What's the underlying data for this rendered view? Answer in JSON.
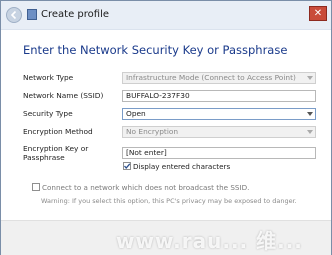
{
  "window": {
    "title": "Create profile",
    "close_glyph": "✕"
  },
  "heading": "Enter the Network Security Key or Passphrase",
  "form": {
    "network_type": {
      "label": "Network Type",
      "value": "Infrastructure Mode (Connect to Access Point)"
    },
    "network_name": {
      "label": "Network Name (SSID)",
      "value": "BUFFALO-237F30"
    },
    "security_type": {
      "label": "Security Type",
      "value": "Open"
    },
    "encryption_method": {
      "label": "Encryption Method",
      "value": "No Encryption"
    },
    "encryption_key": {
      "label_line1": "Encryption Key or",
      "label_line2": "Passphrase",
      "value": "[Not enter]"
    },
    "display_chars": {
      "label": "Display entered characters",
      "checked": true
    },
    "hidden_ssid": {
      "label": "Connect to a network which does not broadcast the SSID.",
      "checked": false
    },
    "warning": "Warning: If you select this option, this PC's privacy may be exposed to danger."
  },
  "watermark": "www.rau... 维..."
}
